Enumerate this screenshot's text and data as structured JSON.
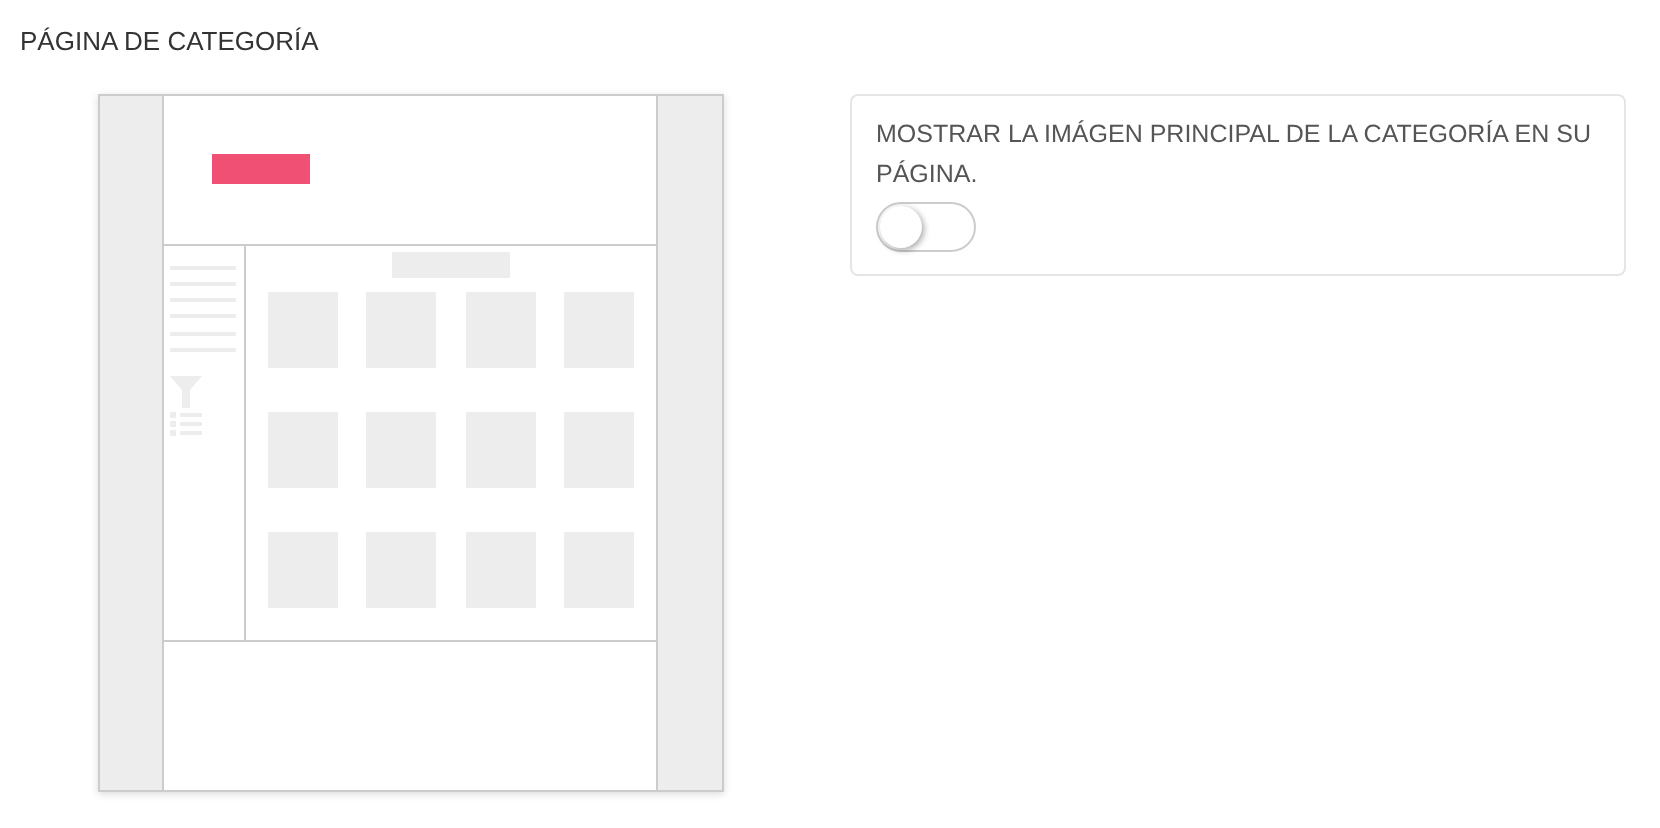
{
  "section_title": "PÁGINA DE CATEGORÍA",
  "setting": {
    "label": "MOSTRAR LA IMÁGEN PRINCIPAL DE LA CATEGORÍA EN SU PÁGINA.",
    "on": false
  }
}
